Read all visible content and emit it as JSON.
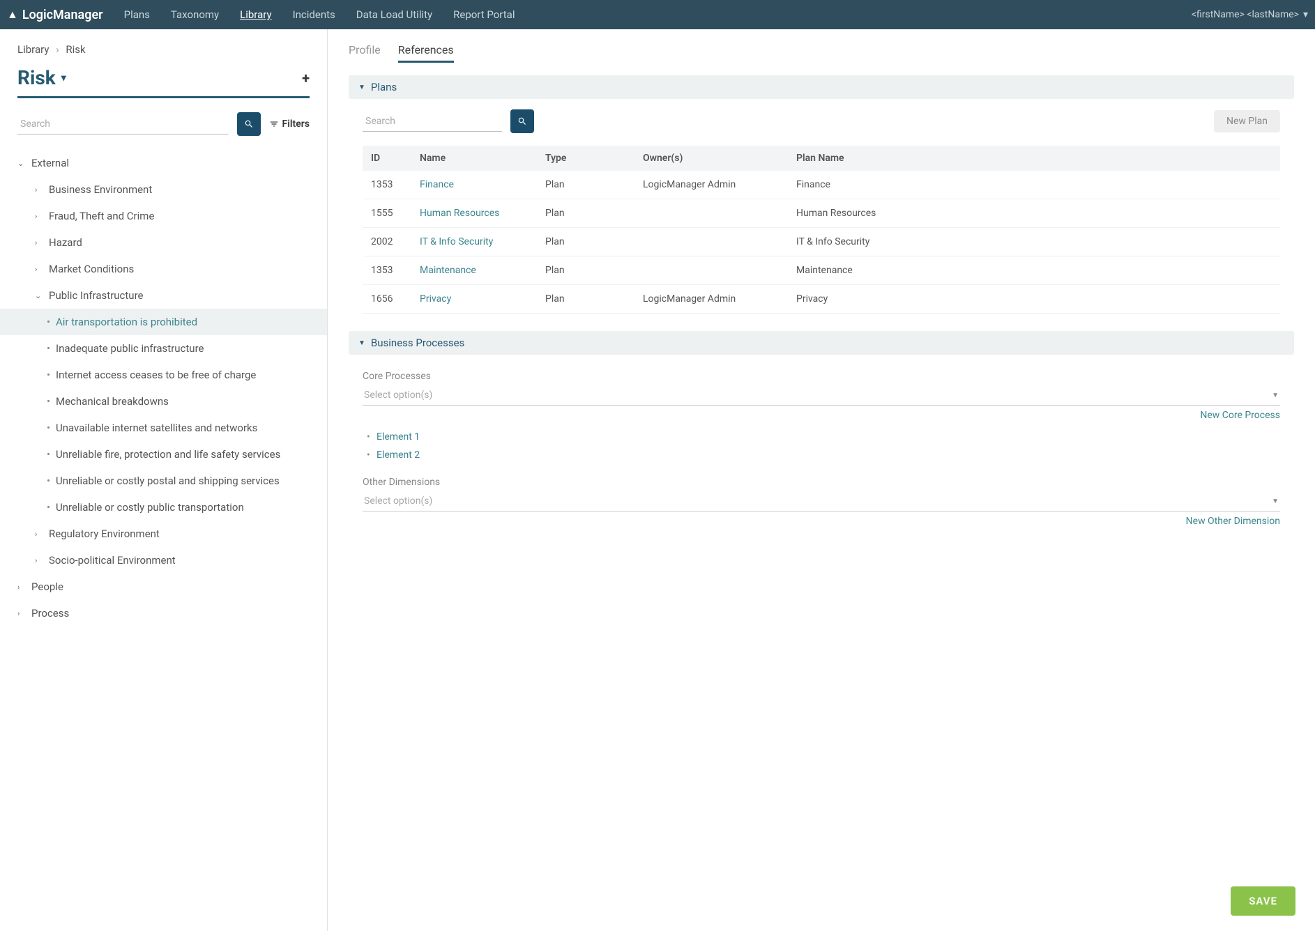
{
  "brand": "LogicManager",
  "nav": {
    "items": [
      "Plans",
      "Taxonomy",
      "Library",
      "Incidents",
      "Data Load Utility",
      "Report Portal"
    ],
    "active": "Library"
  },
  "user_menu": "<firstName> <lastName>",
  "breadcrumb": {
    "a": "Library",
    "b": "Risk"
  },
  "heading": "Risk",
  "sidebar_search_placeholder": "Search",
  "filters_label": "Filters",
  "tree": {
    "root": "External",
    "groups": [
      {
        "label": "Business Environment"
      },
      {
        "label": "Fraud, Theft and Crime"
      },
      {
        "label": "Hazard"
      },
      {
        "label": "Market Conditions"
      },
      {
        "label": "Public Infrastructure",
        "expanded": true,
        "children": [
          "Air transportation is prohibited",
          "Inadequate public infrastructure",
          "Internet access ceases to be free of charge",
          "Mechanical breakdowns",
          "Unavailable internet satellites and networks",
          "Unreliable fire, protection and life safety services",
          "Unreliable or costly postal and shipping services",
          "Unreliable or costly public transportation"
        ]
      },
      {
        "label": "Regulatory Environment"
      },
      {
        "label": "Socio-political Environment"
      }
    ],
    "top_level_after": [
      "People",
      "Process"
    ],
    "selected": "Air transportation is prohibited"
  },
  "tabs": {
    "items": [
      "Profile",
      "References"
    ],
    "active": "References"
  },
  "plans_section": {
    "title": "Plans",
    "search_placeholder": "Search",
    "new_plan_label": "New Plan",
    "columns": [
      "ID",
      "Name",
      "Type",
      "Owner(s)",
      "Plan Name"
    ],
    "rows": [
      {
        "id": "1353",
        "name": "Finance",
        "type": "Plan",
        "owner": "LogicManager Admin",
        "plan": "Finance"
      },
      {
        "id": "1555",
        "name": "Human Resources",
        "type": "Plan",
        "owner": "",
        "plan": "Human Resources"
      },
      {
        "id": "2002",
        "name": "IT & Info Security",
        "type": "Plan",
        "owner": "",
        "plan": "IT & Info Security"
      },
      {
        "id": "1353",
        "name": "Maintenance",
        "type": "Plan",
        "owner": "",
        "plan": "Maintenance"
      },
      {
        "id": "1656",
        "name": "Privacy",
        "type": "Plan",
        "owner": "LogicManager Admin",
        "plan": "Privacy"
      }
    ]
  },
  "bp_section": {
    "title": "Business Processes",
    "core_label": "Core Processes",
    "select_placeholder": "Select option(s)",
    "new_core_label": "New Core Process",
    "elements": [
      "Element 1",
      "Element 2"
    ],
    "other_label": "Other Dimensions",
    "new_other_label": "New Other Dimension"
  },
  "save_label": "SAVE"
}
